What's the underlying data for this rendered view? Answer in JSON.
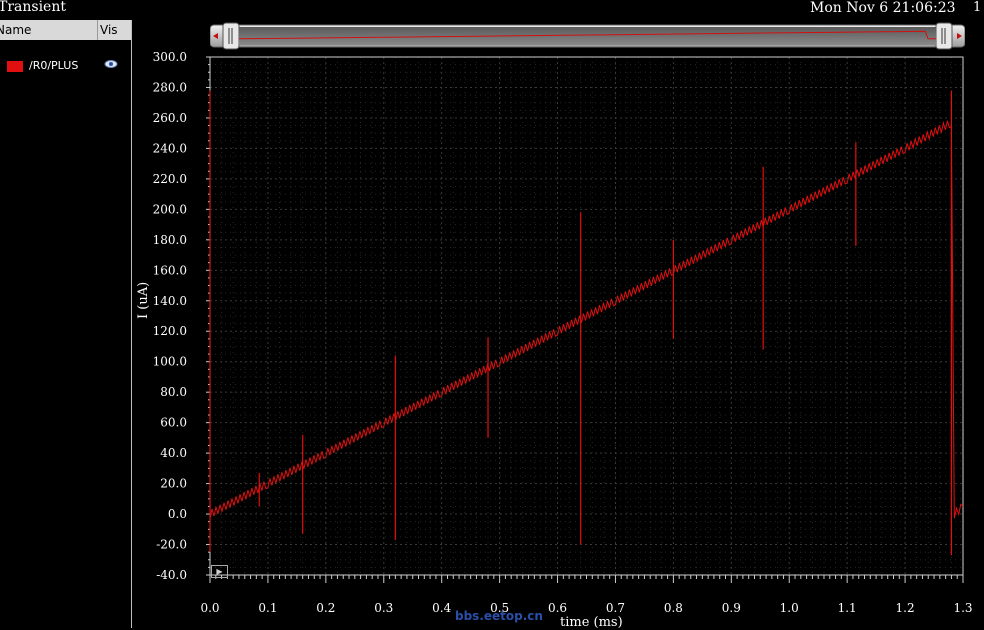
{
  "window": {
    "title": "Transient",
    "timestamp": "Mon Nov 6 21:06:23",
    "subplot_number": "1"
  },
  "legend": {
    "col_name": "Name",
    "col_vis": "Vis",
    "items": [
      {
        "label": "/R0/PLUS",
        "color": "#e01010",
        "vis_icon": "eye-icon"
      }
    ]
  },
  "watermark": "bbs.eetop.cn",
  "chart_data": {
    "type": "line",
    "xlabel": "time (ms)",
    "ylabel": "I (uA)",
    "xlim": [
      0.0,
      1.3
    ],
    "ylim": [
      -40.0,
      300.0
    ],
    "x_ticks": [
      "0.0",
      "0.1",
      "0.2",
      "0.3",
      "0.4",
      "0.5",
      "0.6",
      "0.7",
      "0.8",
      "0.9",
      "1.0",
      "1.1",
      "1.2",
      "1.3"
    ],
    "y_ticks": [
      "300.0",
      "280.0",
      "260.0",
      "240.0",
      "220.0",
      "200.0",
      "180.0",
      "160.0",
      "140.0",
      "120.0",
      "100.0",
      "80.0",
      "60.0",
      "40.0",
      "20.0",
      "0.0",
      "-20.0",
      "-40.0"
    ],
    "grid": true,
    "series": [
      {
        "name": "/R0/PLUS",
        "color": "#e01010",
        "x": [
          0.0,
          0.1,
          0.2,
          0.3,
          0.4,
          0.5,
          0.6,
          0.7,
          0.8,
          0.9,
          1.0,
          1.1,
          1.2,
          1.28,
          1.285,
          1.3
        ],
        "y": [
          0.0,
          20.0,
          40.0,
          60.0,
          80.0,
          100.0,
          120.0,
          140.0,
          160.0,
          180.0,
          200.0,
          220.0,
          240.0,
          257.0,
          0.0,
          5.0
        ]
      }
    ],
    "spikes": [
      {
        "x": 0.0,
        "ymin": -25.0,
        "ymax": 278.0
      },
      {
        "x": 0.085,
        "ymin": 5.0,
        "ymax": 27.0
      },
      {
        "x": 0.16,
        "ymin": -13.0,
        "ymax": 52.0
      },
      {
        "x": 0.32,
        "ymin": -17.0,
        "ymax": 104.0
      },
      {
        "x": 0.48,
        "ymin": 50.0,
        "ymax": 116.0
      },
      {
        "x": 0.64,
        "ymin": -20.0,
        "ymax": 198.0
      },
      {
        "x": 0.8,
        "ymin": 115.0,
        "ymax": 180.0
      },
      {
        "x": 0.955,
        "ymin": 108.0,
        "ymax": 228.0
      },
      {
        "x": 1.115,
        "ymin": 176.0,
        "ymax": 244.0
      },
      {
        "x": 1.28,
        "ymin": -27.0,
        "ymax": 278.0
      }
    ]
  }
}
